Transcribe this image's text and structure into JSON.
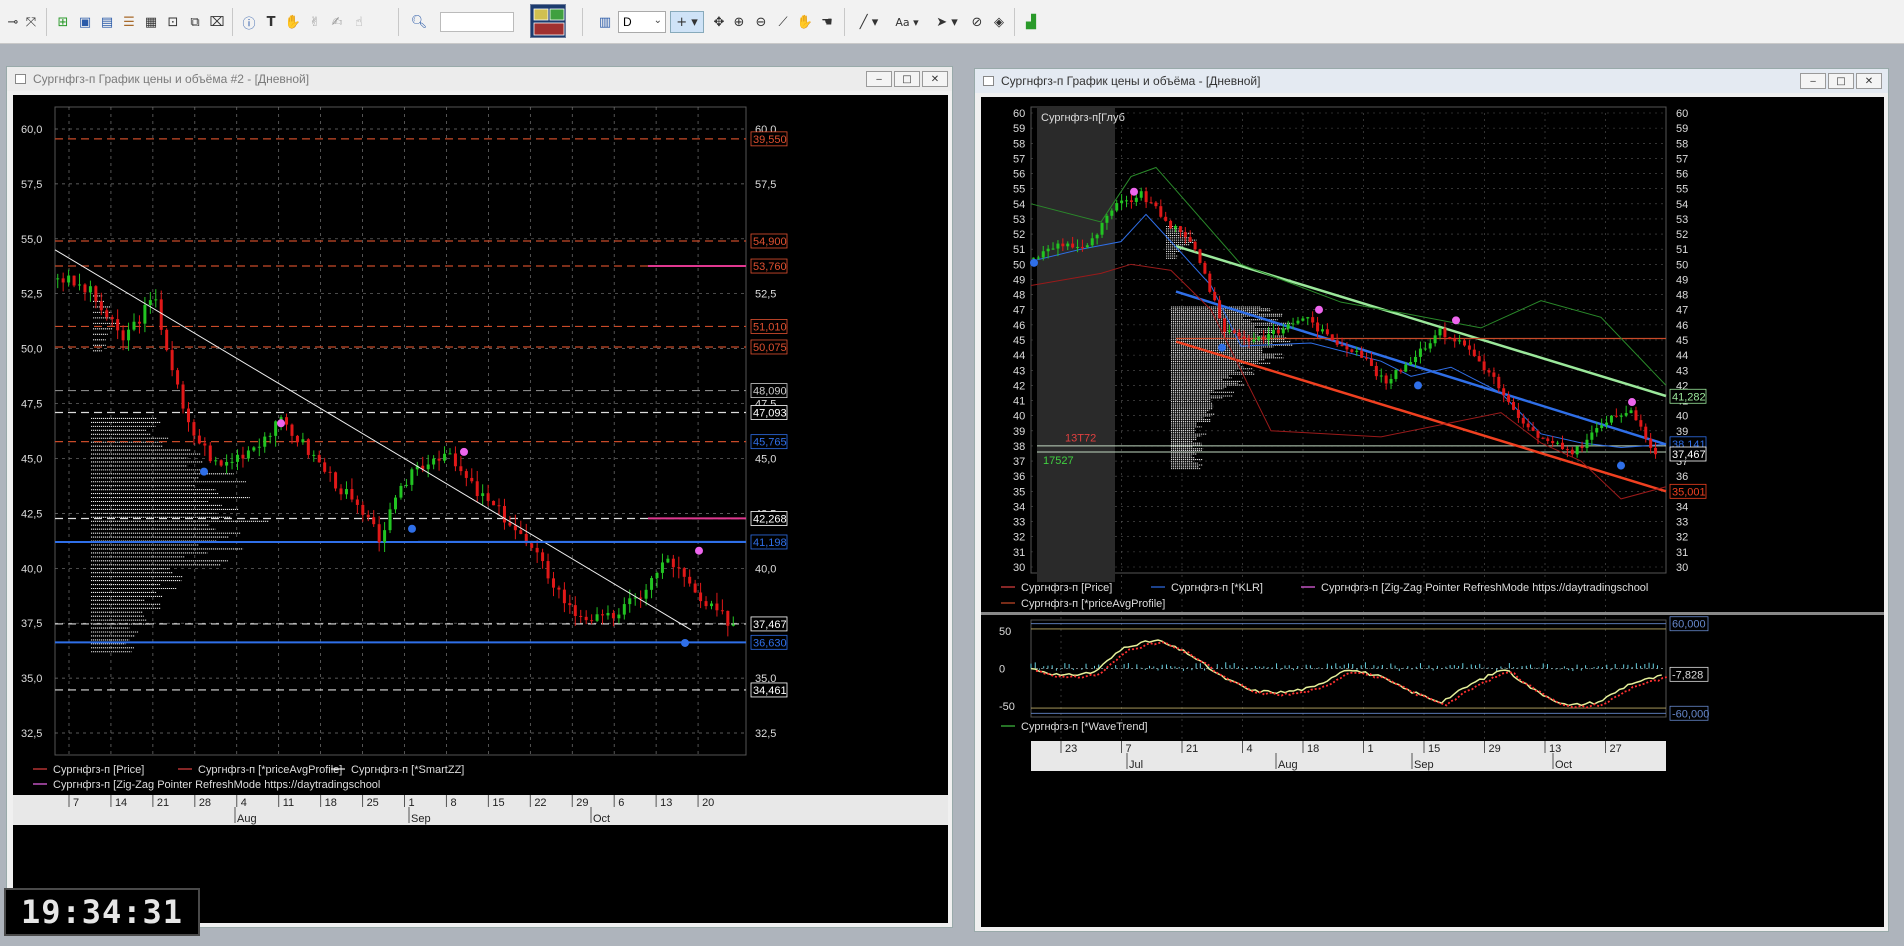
{
  "toolbar": {
    "icons": [
      "cursor-icon",
      "crosshair-tool-icon",
      "new-window-icon",
      "chart-window-icon",
      "table-icon",
      "list-icon",
      "portfolio-icon",
      "scanner-icon",
      "screener-icon",
      "alert-icon",
      "text-tool-icon",
      "hand-tool-icon",
      "hand-tool2-icon",
      "hand-tool3-icon",
      "hand-tool4-icon",
      "search-icon",
      "chart-type-icon",
      "crosshair-icon",
      "move-icon",
      "zoom-in-icon",
      "zoom-out-icon",
      "ruler-icon",
      "pan-icon",
      "hand-icon",
      "line-tool-icon",
      "text-size-icon",
      "arrow-tool-icon",
      "hide-icon",
      "layers-icon",
      "indicator-icon"
    ],
    "search_value": "",
    "period_value": "D",
    "font_label": "Aa"
  },
  "left": {
    "title": "Сургнфгз-п График цены и объёма #2 - [Дневной]",
    "y_ticks": [
      "60,0",
      "57,5",
      "55,0",
      "52,5",
      "50,0",
      "47,5",
      "45,0",
      "42,5",
      "40,0",
      "37,5",
      "35,0",
      "32,5"
    ],
    "right_labels": [
      "39,550",
      "54,900",
      "53,760",
      "51,010",
      "50,075",
      "48,090",
      "47,093",
      "45,765",
      "42,268",
      "41,198",
      "37,467",
      "36,630",
      "34,461"
    ],
    "legend": [
      "Сургнфгз-п [Price]",
      "Сургнфгз-п [*priceAvgProfile]",
      "Сургнфгз-п [*SmartZZ]",
      "Сургнфгз-п [Zig-Zag Pointer RefreshMode https://daytradingschool"
    ],
    "x_days": [
      "7",
      "14",
      "21",
      "28",
      "4",
      "11",
      "18",
      "25",
      "1",
      "8",
      "15",
      "22",
      "29",
      "6",
      "13",
      "20"
    ],
    "x_months": [
      "Aug",
      "Sep",
      "Oct"
    ]
  },
  "right": {
    "title": "Сургнфгз-п График цены и объёма - [Дневной]",
    "overlay_title": "Сургнфгз-п[Глуб",
    "y_ticks": [
      "60",
      "59",
      "58",
      "57",
      "56",
      "55",
      "54",
      "53",
      "52",
      "51",
      "50",
      "49",
      "48",
      "47",
      "46",
      "45",
      "44",
      "43",
      "42",
      "41",
      "40",
      "39",
      "38",
      "37",
      "36",
      "35",
      "34",
      "33",
      "32",
      "31",
      "30"
    ],
    "right_labels": [
      "41,282",
      "38,141",
      "37,467",
      "35,001"
    ],
    "depth_sell": "13T72",
    "depth_buy": "17527",
    "legend": [
      "Сургнфгз-п [Price]",
      "Сургнфгз-п [*KLR]",
      "Сургнфгз-п [Zig-Zag Pointer RefreshMode https://daytradingschool",
      "Сургнфгз-п [*priceAvgProfile]"
    ],
    "osc_ticks": [
      "50",
      "0",
      "-50"
    ],
    "osc_right_labels": [
      "60,000",
      "-7,828",
      "-60,000"
    ],
    "osc_legend": "Сургнфгз-п [*WaveTrend]",
    "x_days": [
      "23",
      "7",
      "21",
      "4",
      "18",
      "1",
      "15",
      "29",
      "13",
      "27"
    ],
    "x_months": [
      "Jul",
      "Aug",
      "Sep",
      "Oct"
    ]
  },
  "clock": "19:34:31",
  "colors": {
    "bg": "#000000",
    "up": "#22c422",
    "down": "#e01818",
    "zz": "#ee66ee",
    "blue": "#2f6fe8",
    "level": "#c84a28"
  },
  "chart_data": [
    {
      "type": "candlestick",
      "title": "Сургнфгз-п График цены и объёма #2 - [Дневной]",
      "ylim": [
        31.5,
        61
      ],
      "x": [
        "7",
        "14",
        "21",
        "28",
        "4",
        "11",
        "18",
        "25",
        "1",
        "8",
        "15",
        "22",
        "29",
        "6",
        "13",
        "20"
      ],
      "close": [
        52.6,
        50.4,
        46.6,
        44.8,
        45.9,
        46.7,
        44.9,
        43.2,
        41.4,
        44.8,
        43.5,
        41.8,
        38.5,
        37.6,
        40.2,
        37.5
      ],
      "series": [
        {
          "name": "Сургнфгз-п [Price]"
        }
      ],
      "levels": [
        59.55,
        54.9,
        53.76,
        51.01,
        50.075,
        48.09,
        47.093,
        45.765,
        42.268,
        41.198,
        37.467,
        36.63,
        34.461
      ]
    },
    {
      "type": "candlestick",
      "title": "Сургнфгз-п График цены и объёма - [Дневной]",
      "ylim": [
        30,
        60
      ],
      "x": [
        "23",
        "7",
        "21",
        "4",
        "18",
        "1",
        "15",
        "29",
        "13",
        "27"
      ],
      "close": [
        51.4,
        53.8,
        51.1,
        45.0,
        44.3,
        42.1,
        44.6,
        38.5,
        39.2,
        37.5
      ],
      "series": [
        {
          "name": "Сургнфгз-п [Price]"
        },
        {
          "name": "Сургнфгз-п [*KLR]"
        }
      ],
      "levels": [
        41.282,
        38.141,
        37.467,
        35.001
      ]
    },
    {
      "type": "line",
      "title": "Сургнфгз-п [*WaveTrend]",
      "ylim": [
        -65,
        65
      ],
      "levels": [
        60,
        -7.828,
        -60
      ],
      "series": [
        {
          "name": "Сургнфгз-п [*WaveTrend]",
          "values": [
            0,
            -10,
            -5,
            30,
            38,
            20,
            -10,
            -30,
            -32,
            -25,
            0,
            -10,
            -30,
            -45,
            -20,
            0,
            -30,
            -50,
            -45,
            -20,
            -10
          ]
        }
      ]
    }
  ]
}
